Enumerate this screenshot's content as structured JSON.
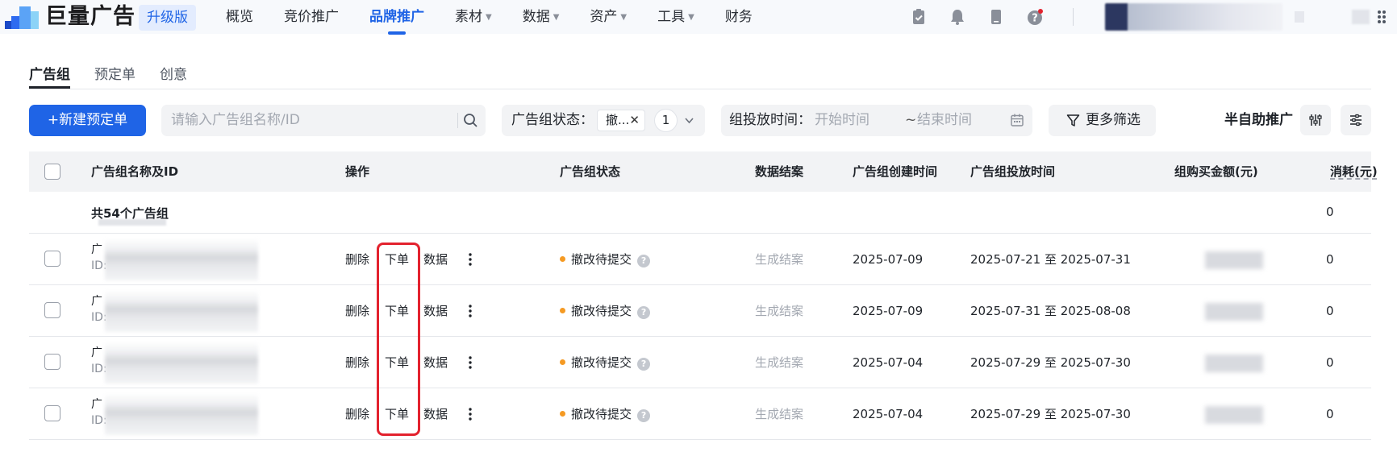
{
  "brand": {
    "name": "巨量广告",
    "tier_tag": "升级版"
  },
  "nav": [
    {
      "label": "概览",
      "caret": false,
      "active": false
    },
    {
      "label": "竞价推广",
      "caret": false,
      "active": false
    },
    {
      "label": "品牌推广",
      "caret": false,
      "active": true
    },
    {
      "label": "素材",
      "caret": true,
      "active": false
    },
    {
      "label": "数据",
      "caret": true,
      "active": false
    },
    {
      "label": "资产",
      "caret": true,
      "active": false
    },
    {
      "label": "工具",
      "caret": true,
      "active": false
    },
    {
      "label": "财务",
      "caret": false,
      "active": false
    }
  ],
  "header_icons": [
    "clipboard-check-icon",
    "bell-icon",
    "phone-icon",
    "help-icon"
  ],
  "subtabs": [
    {
      "label": "广告组",
      "active": true
    },
    {
      "label": "预定单",
      "active": false
    },
    {
      "label": "创意",
      "active": false
    }
  ],
  "toolbar": {
    "new_button": "+新建预定单",
    "search_placeholder": "请输入广告组名称/ID",
    "status_filter": {
      "label": "广告组状态：",
      "tag": "撤...",
      "count": "1"
    },
    "time_filter": {
      "label": "组投放时间：",
      "start_placeholder": "开始时间",
      "tilde": "~",
      "end_placeholder": "结束时间"
    },
    "more_filters": "更多筛选",
    "semi_auto": "半自助推广"
  },
  "table": {
    "headers": {
      "name": "广告组名称及ID",
      "actions": "操作",
      "status": "广告组状态",
      "archive": "数据结案",
      "created": "广告组创建时间",
      "period": "广告组投放时间",
      "amount": "组购买金额(元)",
      "spend": "消耗(元)"
    },
    "summary": {
      "label": "共54个广告组",
      "spend": "0"
    },
    "row_labels": {
      "name_prefix": "广",
      "id_prefix": "ID:",
      "delete": "删除",
      "order": "下单",
      "data": "数据",
      "archive": "生成结案"
    },
    "rows": [
      {
        "status": "撤改待提交",
        "created": "2025-07-09",
        "period": "2025-07-21 至 2025-07-31",
        "spend": "0"
      },
      {
        "status": "撤改待提交",
        "created": "2025-07-09",
        "period": "2025-07-31 至 2025-08-08",
        "spend": "0"
      },
      {
        "status": "撤改待提交",
        "created": "2025-07-04",
        "period": "2025-07-29 至 2025-07-30",
        "spend": "0"
      },
      {
        "status": "撤改待提交",
        "created": "2025-07-04",
        "period": "2025-07-29 至 2025-07-30",
        "spend": "0"
      }
    ]
  },
  "colors": {
    "primary": "#1f64e6",
    "status_dot": "#f59a23",
    "highlight": "#e3222e"
  }
}
